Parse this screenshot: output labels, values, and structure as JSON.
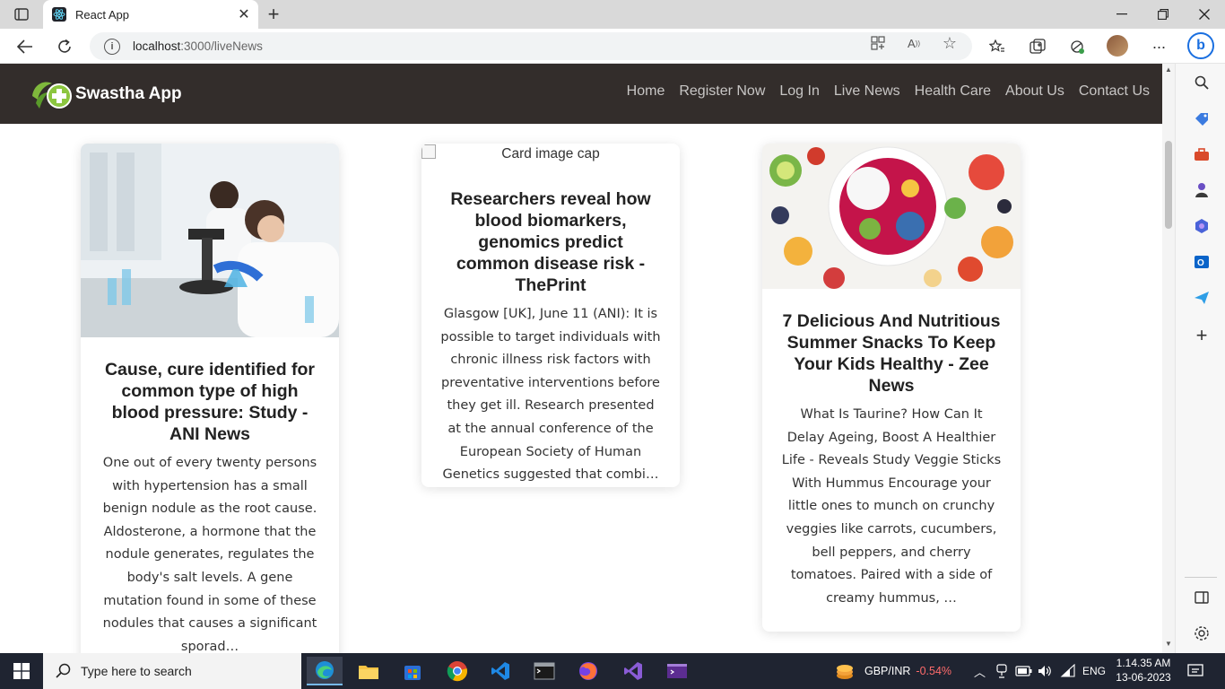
{
  "browser": {
    "tab_title": "React App",
    "url_host": "localhost",
    "url_rest": ":3000/liveNews"
  },
  "navbar": {
    "brand": "Swastha App",
    "links": [
      "Home",
      "Register Now",
      "Log In",
      "Live News",
      "Health Care",
      "About Us",
      "Contact Us"
    ]
  },
  "cards": [
    {
      "title": "Cause, cure identified for common type of high blood pressure: Study - ANI News",
      "text": "One out of every twenty persons with hypertension has a small benign nodule as the root cause. Aldosterone, a hormone that the nodule generates, regulates the body's salt levels. A gene mutation found in some of these nodules that causes a significant sporad…"
    },
    {
      "image_alt": "Card image cap",
      "title": "Researchers reveal how blood biomarkers, genomics predict common disease risk - ThePrint",
      "text": "Glasgow [UK], June 11 (ANI): It is possible to target individuals with chronic illness risk factors with preventative interventions before they get ill. Research presented at the annual conference of the European Society of Human Genetics suggested that combi…"
    },
    {
      "title": "7 Delicious And Nutritious Summer Snacks To Keep Your Kids Healthy - Zee News",
      "text": "What Is Taurine? How Can It Delay Ageing, Boost A Healthier Life - Reveals Study Veggie Sticks With Hummus Encourage your little ones to munch on crunchy veggies like carrots, cucumbers, bell peppers, and cherry tomatoes. Paired with a side of creamy hummus, …"
    }
  ],
  "taskbar": {
    "search_placeholder": "Type here to search",
    "ticker_name": "GBP/INR",
    "ticker_change": "-0.54%",
    "language": "ENG",
    "time": "1.14.35 AM",
    "date": "13-06-2023"
  },
  "colors": {
    "navbar_bg": "#332d2b",
    "ticker_negative": "#ff6b6b",
    "taskbar_bg": "#1f2431"
  }
}
